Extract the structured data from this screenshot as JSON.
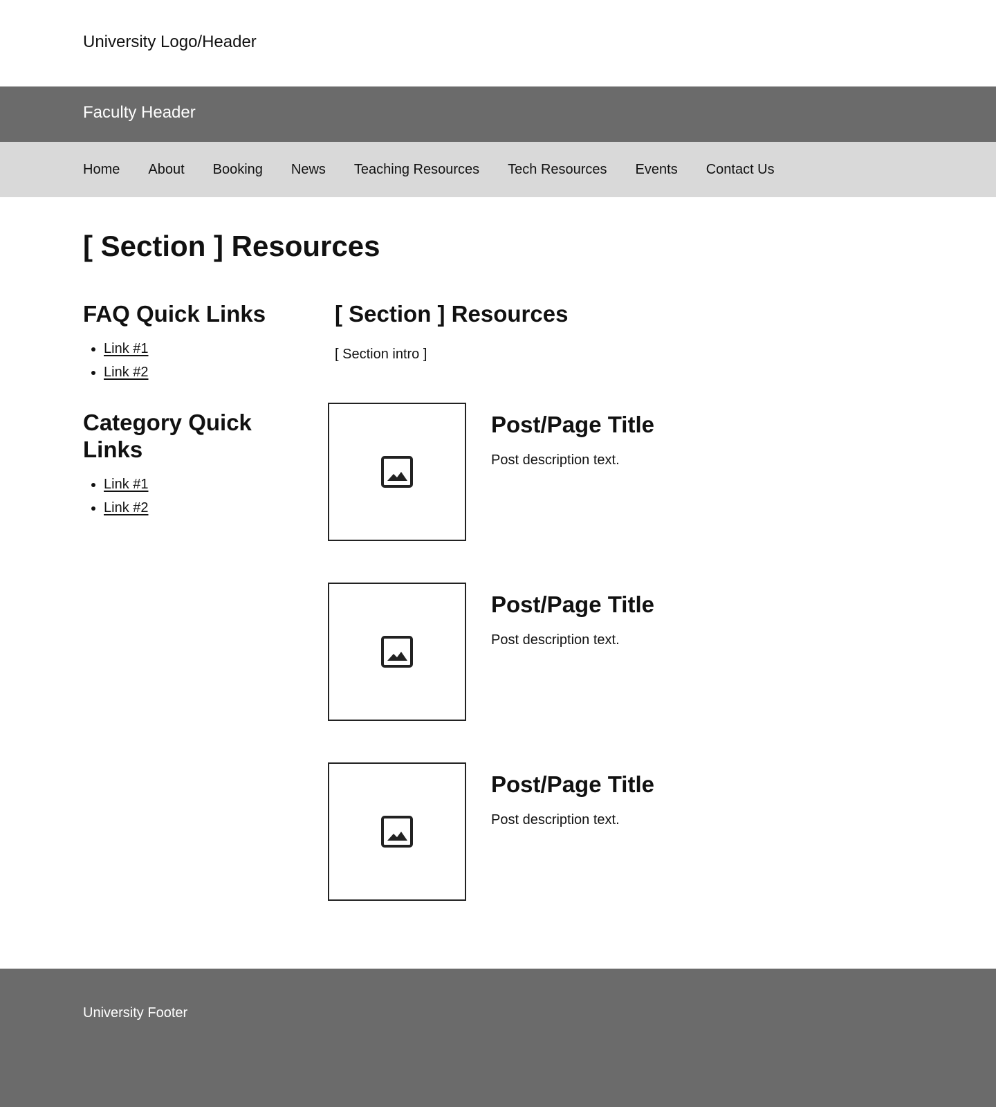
{
  "header": {
    "university": "University Logo/Header",
    "faculty": "Faculty Header"
  },
  "nav": {
    "items": [
      {
        "label": "Home"
      },
      {
        "label": "About"
      },
      {
        "label": "Booking"
      },
      {
        "label": "News"
      },
      {
        "label": "Teaching Resources"
      },
      {
        "label": "Tech Resources"
      },
      {
        "label": "Events"
      },
      {
        "label": "Contact Us"
      }
    ]
  },
  "page": {
    "title": "[ Section ] Resources"
  },
  "sidebar": {
    "faq": {
      "title": "FAQ Quick Links",
      "links": [
        {
          "label": "Link #1"
        },
        {
          "label": "Link #2"
        }
      ]
    },
    "category": {
      "title": "Category Quick Links",
      "links": [
        {
          "label": "Link #1"
        },
        {
          "label": "Link #2"
        }
      ]
    }
  },
  "main": {
    "title": "[ Section ]  Resources",
    "intro": "[ Section intro ]",
    "posts": [
      {
        "title": "Post/Page Title",
        "description": "Post description text.",
        "image_icon": "image-icon"
      },
      {
        "title": "Post/Page Title",
        "description": "Post description text.",
        "image_icon": "image-icon"
      },
      {
        "title": "Post/Page Title",
        "description": "Post description text.",
        "image_icon": "image-icon"
      }
    ]
  },
  "footer": {
    "text": "University Footer"
  },
  "colors": {
    "header_bar": "#6b6b6b",
    "nav_bar": "#d9d9d9",
    "footer_bar": "#6b6b6b"
  }
}
